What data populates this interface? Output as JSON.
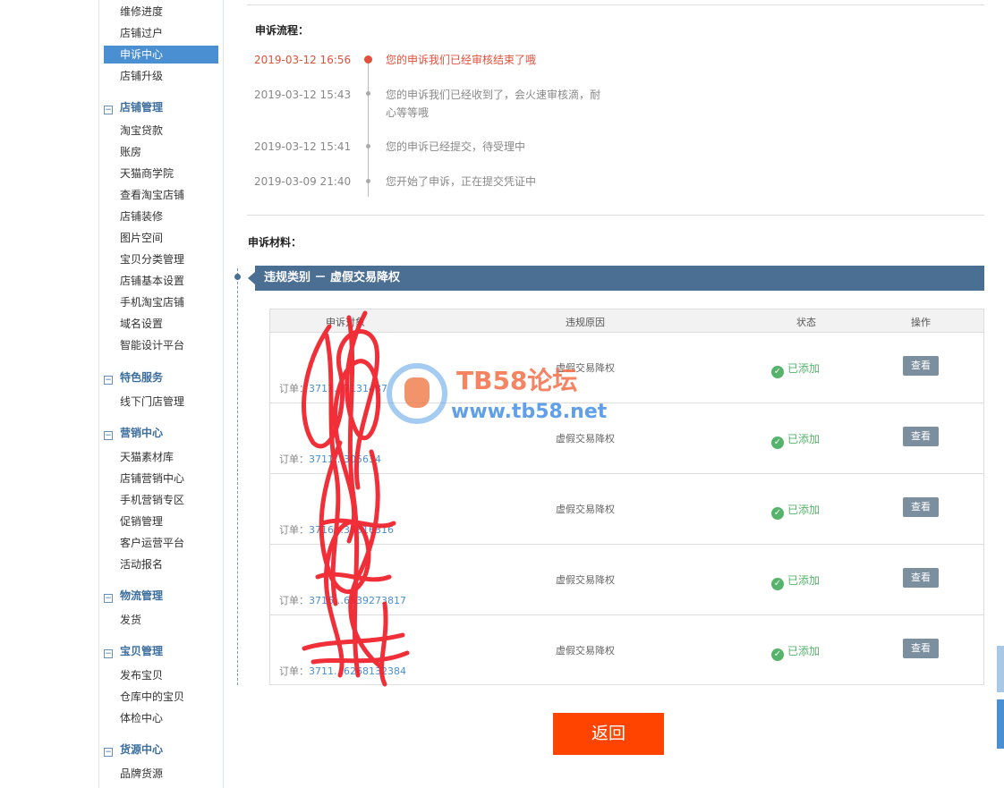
{
  "sidebar": {
    "links_top": [
      "维修进度",
      "店铺过户",
      "申诉中心",
      "店铺升级"
    ],
    "active": "申诉中心",
    "groups": [
      {
        "title": "店铺管理",
        "items": [
          "淘宝贷款",
          "账房",
          "天猫商学院",
          "查看淘宝店铺",
          "店铺装修",
          "图片空间",
          "宝贝分类管理",
          "店铺基本设置",
          "手机淘宝店铺",
          "域名设置",
          "智能设计平台"
        ]
      },
      {
        "title": "特色服务",
        "items": [
          "线下门店管理"
        ]
      },
      {
        "title": "营销中心",
        "items": [
          "天猫素材库",
          "店铺营销中心",
          "手机营销专区",
          "促销管理",
          "客户运营平台",
          "活动报名"
        ]
      },
      {
        "title": "物流管理",
        "items": [
          "发货"
        ]
      },
      {
        "title": "宝贝管理",
        "items": [
          "发布宝贝",
          "仓库中的宝贝",
          "体检中心"
        ]
      },
      {
        "title": "货源中心",
        "items": [
          "品牌货源"
        ]
      }
    ],
    "toggle_symbol": "−"
  },
  "process": {
    "title": "申诉流程：",
    "events": [
      {
        "time": "2019-03-12 16:56",
        "msg": "您的申诉我们已经审核结束了哦",
        "current": true
      },
      {
        "time": "2019-03-12 15:43",
        "msg": "您的申诉我们已经收到了，会火速审核滴，耐心等等哦",
        "current": false
      },
      {
        "time": "2019-03-12 15:41",
        "msg": "您的申诉已经提交，待受理中",
        "current": false
      },
      {
        "time": "2019-03-09 21:40",
        "msg": "您开始了申诉，正在提交凭证中",
        "current": false
      }
    ]
  },
  "materials": {
    "title": "申诉材料：",
    "category": "违规类别 － 虚假交易降权",
    "columns": [
      "申诉对象",
      "违规原因",
      "状态",
      "操作"
    ],
    "order_label": "订单：",
    "rows": [
      {
        "order": "3711…7131487",
        "reason": "虚假交易降权",
        "status": "已添加",
        "action": "查看"
      },
      {
        "order": "3711…305634",
        "reason": "虚假交易降权",
        "status": "已添加",
        "action": "查看"
      },
      {
        "order": "3716…35816316",
        "reason": "虚假交易降权",
        "status": "已添加",
        "action": "查看"
      },
      {
        "order": "3716…6539273817",
        "reason": "虚假交易降权",
        "status": "已添加",
        "action": "查看"
      },
      {
        "order": "3711…6268132384",
        "reason": "虚假交易降权",
        "status": "已添加",
        "action": "查看"
      }
    ]
  },
  "back_button": "返回",
  "watermark": {
    "title": "TB58论坛",
    "url": "www.tb58.net"
  },
  "colors": {
    "accent": "#4a8fd1",
    "category_bar": "#4b6e93",
    "current_event": "#e0503c",
    "ok": "#56b36b",
    "back_button": "#ff4400"
  }
}
